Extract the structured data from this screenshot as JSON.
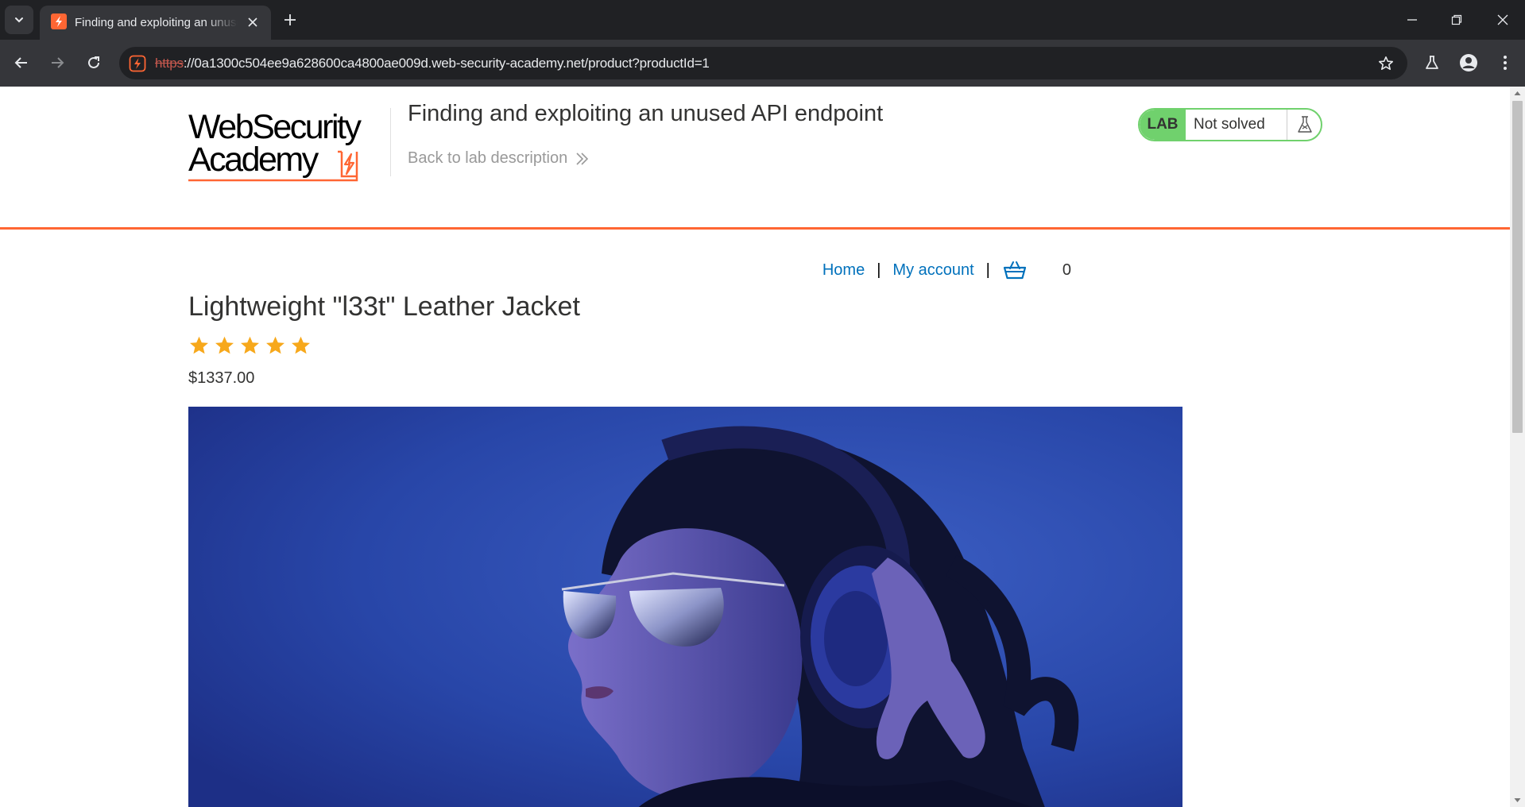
{
  "browser": {
    "tab": {
      "title": "Finding and exploiting an unused API endpoint"
    },
    "address_bar": {
      "scheme": "https",
      "rest": "://0a1300c504ee9a628600ca4800ae009d.web-security-academy.net/product?productId=1"
    }
  },
  "header": {
    "logo_line1": "WebSecurity",
    "logo_line2": "Academy",
    "lab_title": "Finding and exploiting an unused API endpoint",
    "back_link": "Back to lab description",
    "lab_badge": "LAB",
    "lab_status": "Not solved"
  },
  "nav": {
    "home": "Home",
    "sep": "|",
    "my_account": "My account",
    "cart_count": "0"
  },
  "product": {
    "title": "Lightweight \"l33t\" Leather Jacket",
    "rating_stars": 5,
    "price": "$1337.00"
  },
  "colors": {
    "brand_orange": "#ff6633",
    "lab_green": "#70d16d",
    "link_blue": "#0071bc",
    "star_orange": "#f7a81b"
  }
}
